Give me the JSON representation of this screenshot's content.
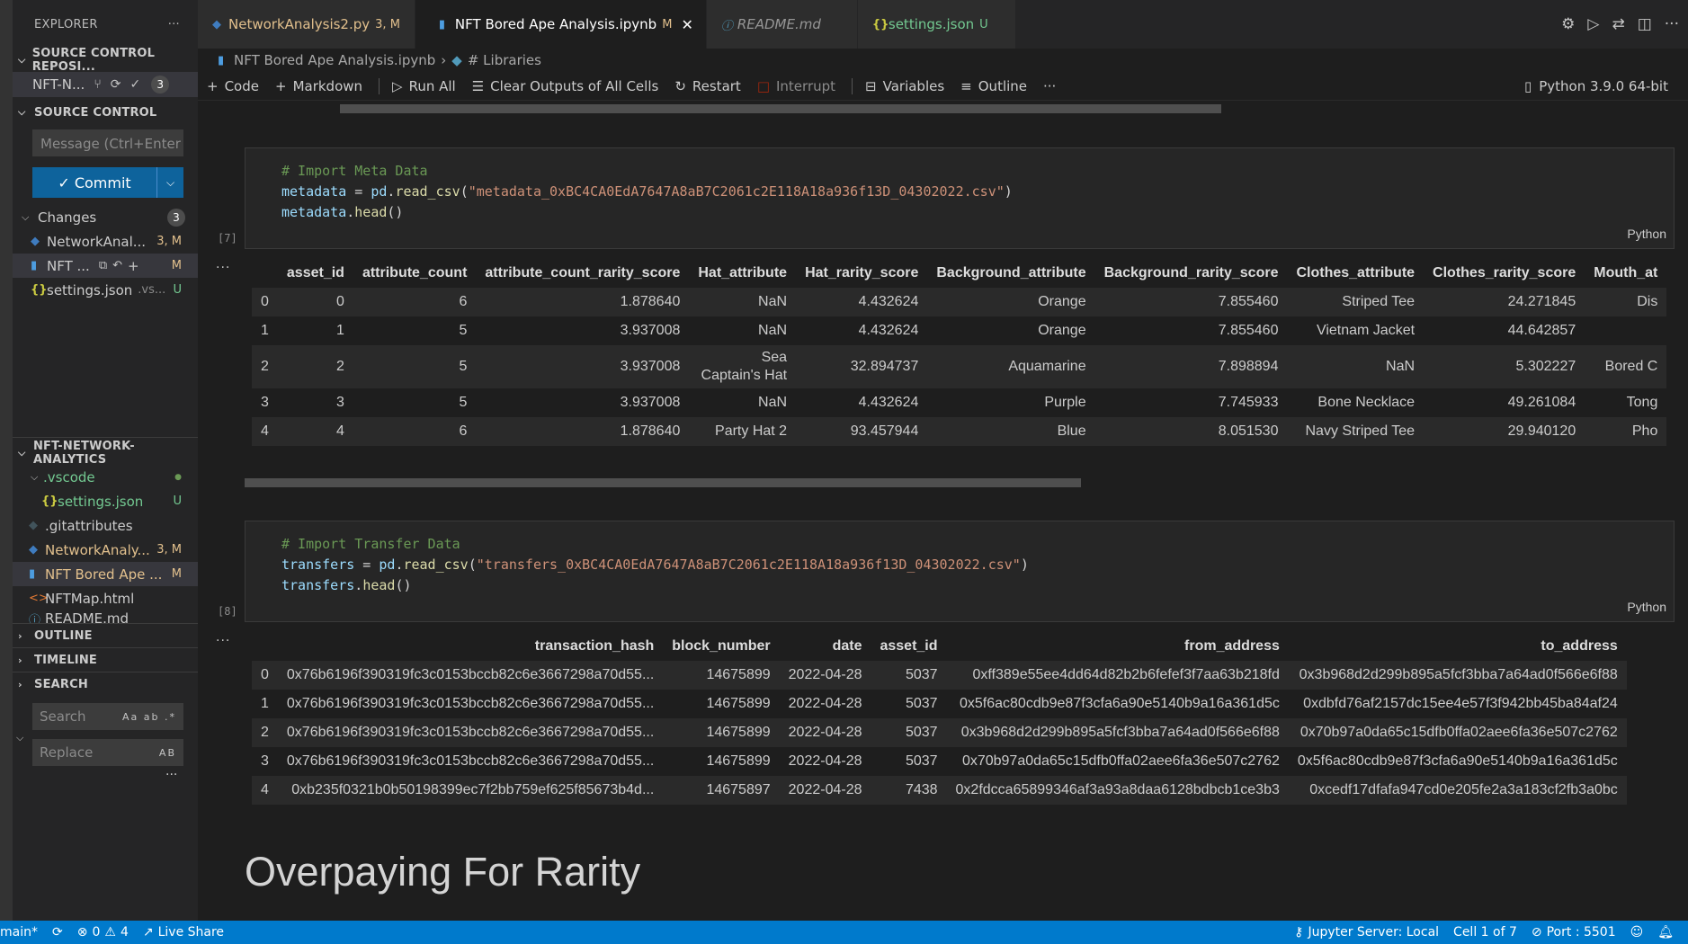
{
  "explorer": {
    "title": "EXPLORER",
    "more": "···"
  },
  "source_control_repos": {
    "header": "SOURCE CONTROL REPOSI...",
    "repo_name": "NFT-N...",
    "badge": "3"
  },
  "source_control": {
    "header": "SOURCE CONTROL",
    "message_placeholder": "Message (Ctrl+Enter ...",
    "commit_label": "Commit",
    "changes_label": "Changes",
    "changes_count": "3",
    "files": [
      {
        "name": "NetworkAnal...",
        "status": "3, M"
      },
      {
        "name": "NFT ...",
        "status": "M"
      },
      {
        "name": "settings.json",
        "extra": ".vs...",
        "status": "U"
      }
    ]
  },
  "project": {
    "header": "NFT-NETWORK-ANALYTICS",
    "items": [
      {
        "name": ".vscode",
        "status": "●"
      },
      {
        "name": "settings.json",
        "status": "U"
      },
      {
        "name": ".gitattributes",
        "status": ""
      },
      {
        "name": "NetworkAnaly...",
        "status": "3, M"
      },
      {
        "name": "NFT Bored Ape ...",
        "status": "M"
      },
      {
        "name": "NFTMap.html",
        "status": ""
      },
      {
        "name": "README.md",
        "status": ""
      }
    ]
  },
  "outline_header": "OUTLINE",
  "timeline_header": "TIMELINE",
  "search": {
    "header": "SEARCH",
    "search_placeholder": "Search",
    "replace_placeholder": "Replace",
    "search_opts": "Aa ab .*",
    "replace_opt": "AB"
  },
  "tabs": [
    {
      "label": "NetworkAnalysis2.py",
      "indicator": "3, M"
    },
    {
      "label": "NFT Bored Ape Analysis.ipynb",
      "indicator": "M"
    },
    {
      "label": "README.md",
      "indicator": ""
    },
    {
      "label": "settings.json",
      "indicator": "U"
    }
  ],
  "breadcrumb": {
    "file": "NFT Bored Ape Analysis.ipynb",
    "section": "# Libraries"
  },
  "toolbar": {
    "code": "Code",
    "markdown": "Markdown",
    "run_all": "Run All",
    "clear_outputs": "Clear Outputs of All Cells",
    "restart": "Restart",
    "interrupt": "Interrupt",
    "variables": "Variables",
    "outline": "Outline",
    "more": "···",
    "kernel": "Python 3.9.0 64-bit"
  },
  "cell7": {
    "exec_count": "[7]",
    "comment": "# Import Meta Data",
    "line2_var": "metadata",
    "line2_eq": " = ",
    "line2_mod": "pd",
    "line2_fn": "read_csv",
    "line2_arg": "\"metadata_0xBC4CA0EdA7647A8aB7C2061c2E118A18a936f13D_04302022.csv\"",
    "line3_var": "metadata",
    "line3_fn": "head",
    "lang": "Python"
  },
  "df1": {
    "columns": [
      "",
      "asset_id",
      "attribute_count",
      "attribute_count_rarity_score",
      "Hat_attribute",
      "Hat_rarity_score",
      "Background_attribute",
      "Background_rarity_score",
      "Clothes_attribute",
      "Clothes_rarity_score",
      "Mouth_at"
    ],
    "rows": [
      [
        "0",
        "0",
        "6",
        "1.878640",
        "NaN",
        "4.432624",
        "Orange",
        "7.855460",
        "Striped Tee",
        "24.271845",
        "Dis"
      ],
      [
        "1",
        "1",
        "5",
        "3.937008",
        "NaN",
        "4.432624",
        "Orange",
        "7.855460",
        "Vietnam Jacket",
        "44.642857",
        ""
      ],
      [
        "2",
        "2",
        "5",
        "3.937008",
        "Sea Captain's Hat",
        "32.894737",
        "Aquamarine",
        "7.898894",
        "NaN",
        "5.302227",
        "Bored C"
      ],
      [
        "3",
        "3",
        "5",
        "3.937008",
        "NaN",
        "4.432624",
        "Purple",
        "7.745933",
        "Bone Necklace",
        "49.261084",
        "Tong"
      ],
      [
        "4",
        "4",
        "6",
        "1.878640",
        "Party Hat 2",
        "93.457944",
        "Blue",
        "8.051530",
        "Navy Striped Tee",
        "29.940120",
        "Pho"
      ]
    ]
  },
  "cell8": {
    "exec_count": "[8]",
    "comment": "# Import Transfer Data",
    "line2_var": "transfers",
    "line2_eq": " = ",
    "line2_mod": "pd",
    "line2_fn": "read_csv",
    "line2_arg": "\"transfers_0xBC4CA0EdA7647A8aB7C2061c2E118A18a936f13D_04302022.csv\"",
    "line3_var": "transfers",
    "line3_fn": "head",
    "lang": "Python"
  },
  "df2": {
    "columns": [
      "",
      "transaction_hash",
      "block_number",
      "date",
      "asset_id",
      "from_address",
      "to_address"
    ],
    "rows": [
      [
        "0",
        "0x76b6196f390319fc3c0153bccb82c6e3667298a70d55...",
        "14675899",
        "2022-04-28",
        "5037",
        "0xff389e55ee4dd64d82b2b6fefef3f7aa63b218fd",
        "0x3b968d2d299b895a5fcf3bba7a64ad0f566e6f88"
      ],
      [
        "1",
        "0x76b6196f390319fc3c0153bccb82c6e3667298a70d55...",
        "14675899",
        "2022-04-28",
        "5037",
        "0x5f6ac80cdb9e87f3cfa6a90e5140b9a16a361d5c",
        "0xdbfd76af2157dc15ee4e57f3f942bb45ba84af24"
      ],
      [
        "2",
        "0x76b6196f390319fc3c0153bccb82c6e3667298a70d55...",
        "14675899",
        "2022-04-28",
        "5037",
        "0x3b968d2d299b895a5fcf3bba7a64ad0f566e6f88",
        "0x70b97a0da65c15dfb0ffa02aee6fa36e507c2762"
      ],
      [
        "3",
        "0x76b6196f390319fc3c0153bccb82c6e3667298a70d55...",
        "14675899",
        "2022-04-28",
        "5037",
        "0x70b97a0da65c15dfb0ffa02aee6fa36e507c2762",
        "0x5f6ac80cdb9e87f3cfa6a90e5140b9a16a361d5c"
      ],
      [
        "4",
        "0xb235f0321b0b50198399ec7f2bb759ef625f85673b4d...",
        "14675897",
        "2022-04-28",
        "7438",
        "0x2fdcca65899346af3a93a8daa6128bdbcb1ce3b3",
        "0xcedf17dfafa947cd0e205fe2a3a183cf2fb3a0bc"
      ]
    ]
  },
  "markdown_heading": "Overpaying For Rarity",
  "status": {
    "branch": "main*",
    "errors": "0",
    "warnings": "4",
    "live_share": "Live Share",
    "jupyter": "Jupyter Server: Local",
    "cell": "Cell 1 of 7",
    "port": "Port : 5501"
  },
  "colors": {
    "accent": "#007acc",
    "commit_button": "#0e639c",
    "modified": "#e2c08d",
    "untracked": "#73c991"
  }
}
